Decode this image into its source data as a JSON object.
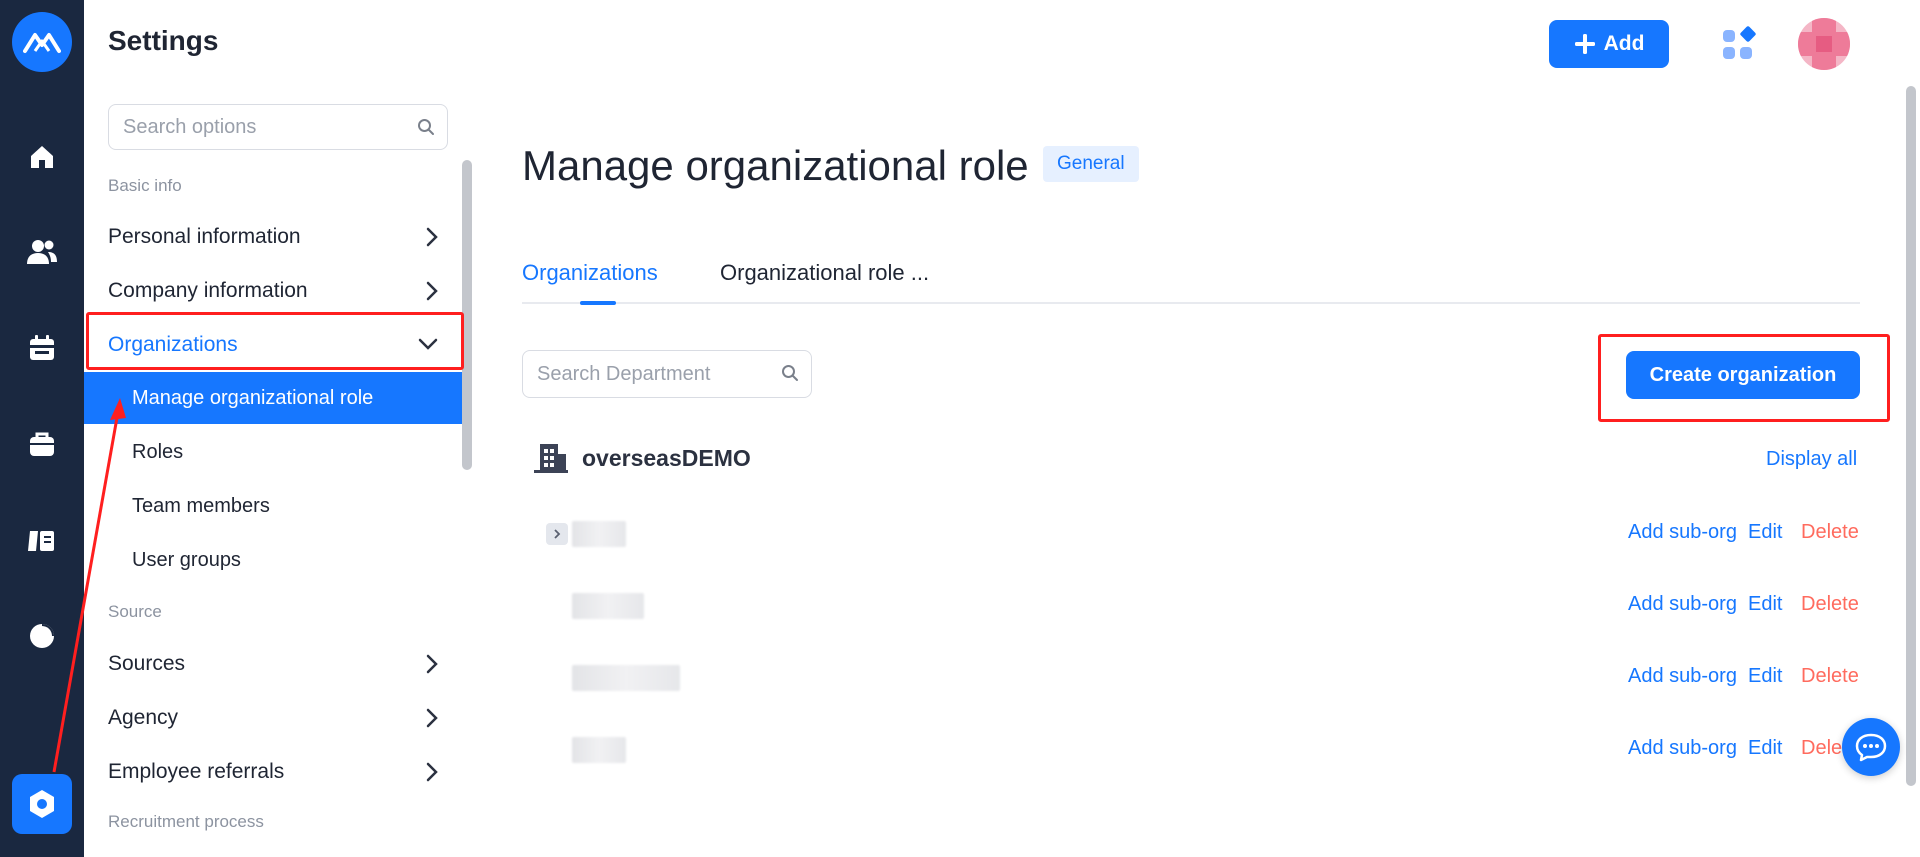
{
  "header": {
    "title": "Settings",
    "add_label": "Add"
  },
  "menu": {
    "search_placeholder": "Search options",
    "sections": {
      "basic_info": "Basic info",
      "source": "Source",
      "recruitment_process": "Recruitment process"
    },
    "items": {
      "personal_information": "Personal information",
      "company_information": "Company information",
      "organizations": "Organizations",
      "sources": "Sources",
      "agency": "Agency",
      "employee_referrals": "Employee referrals"
    },
    "sub_items": {
      "manage_org_role": "Manage organizational role",
      "roles": "Roles",
      "team_members": "Team members",
      "user_groups": "User groups"
    }
  },
  "main": {
    "heading": "Manage organizational role",
    "badge": "General",
    "tabs": {
      "organizations": "Organizations",
      "org_role": "Organizational role ..."
    },
    "dept_search_placeholder": "Search Department",
    "create_label": "Create organization",
    "root_org": "overseasDEMO",
    "display_all": "Display all",
    "row_actions": {
      "add_sub": "Add sub-org",
      "edit": "Edit",
      "delete": "Delete"
    }
  },
  "colors": {
    "primary": "#1677ff",
    "rail_bg": "#1a2840",
    "danger": "#ff6b5e",
    "annotation": "#ff1f1f"
  },
  "icons": [
    "logo-icon",
    "home-icon",
    "people-icon",
    "calendar-icon",
    "briefcase-icon",
    "book-icon",
    "pie-chart-icon",
    "settings-icon",
    "plus-icon",
    "apps-icon",
    "search-icon",
    "chevron-right-icon",
    "chevron-down-icon",
    "building-icon",
    "chat-icon"
  ]
}
